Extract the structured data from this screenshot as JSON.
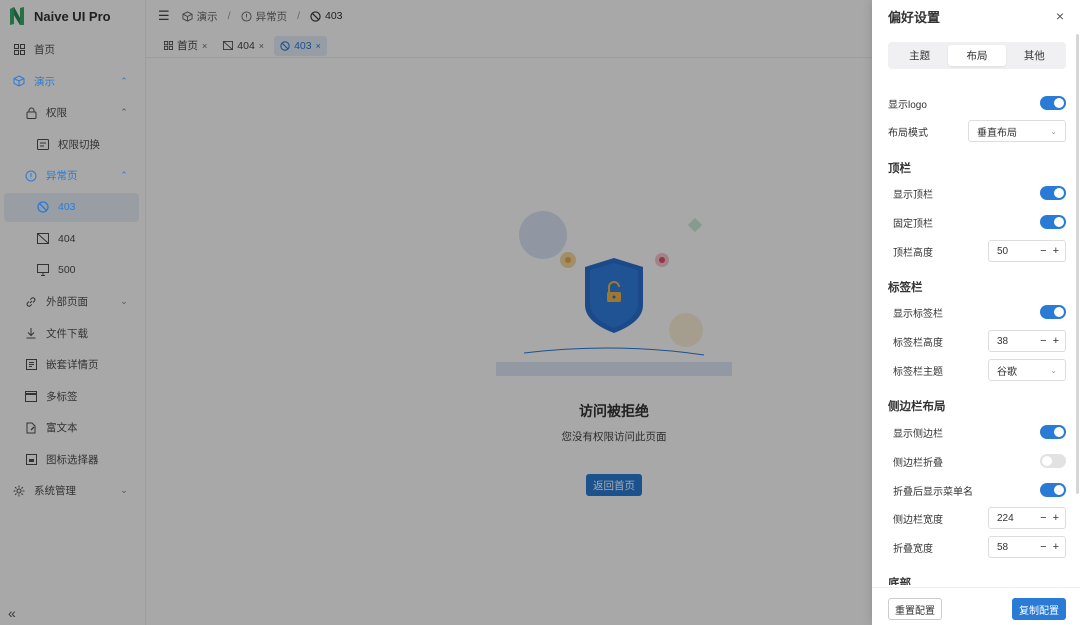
{
  "app": {
    "name": "Naive UI Pro"
  },
  "sidebar": {
    "items": [
      {
        "label": "首页",
        "icon": "dashboard-icon"
      },
      {
        "label": "演示",
        "icon": "cube-icon",
        "chevron": "⌃"
      },
      {
        "label": "权限",
        "icon": "lock-icon",
        "chevron": "⌃"
      },
      {
        "label": "权限切换",
        "icon": "switch-icon"
      },
      {
        "label": "异常页",
        "icon": "warning-circle-icon",
        "chevron": "⌃"
      },
      {
        "label": "403",
        "icon": "forbidden-icon"
      },
      {
        "label": "404",
        "icon": "image-broken-icon"
      },
      {
        "label": "500",
        "icon": "monitor-error-icon"
      },
      {
        "label": "外部页面",
        "icon": "link-icon",
        "chevron": "⌄"
      },
      {
        "label": "文件下载",
        "icon": "download-icon"
      },
      {
        "label": "嵌套详情页",
        "icon": "detail-icon"
      },
      {
        "label": "多标签",
        "icon": "window-icon"
      },
      {
        "label": "富文本",
        "icon": "document-edit-icon"
      },
      {
        "label": "图标选择器",
        "icon": "image-icon"
      },
      {
        "label": "系统管理",
        "icon": "gear-icon",
        "chevron": "⌄"
      }
    ],
    "collapse_glyph": "«"
  },
  "header": {
    "menu_glyph": "☰",
    "breadcrumb": [
      "演示",
      "异常页",
      "403"
    ],
    "sep": "/"
  },
  "tabs": [
    {
      "label": "首页"
    },
    {
      "label": "404"
    },
    {
      "label": "403"
    }
  ],
  "tab_close": "×",
  "main": {
    "title": "访问被拒绝",
    "desc": "您没有权限访问此页面",
    "back_button": "返回首页"
  },
  "drawer": {
    "title": "偏好设置",
    "close": "×",
    "tabs": [
      "主题",
      "布局",
      "其他"
    ],
    "show_logo": "显示logo",
    "layout_mode_label": "布局模式",
    "layout_mode_value": "垂直布局",
    "header_section": "顶栏",
    "show_header": "显示顶栏",
    "fixed_header": "固定顶栏",
    "header_height_label": "顶栏高度",
    "header_height": "50",
    "tabbar_section": "标签栏",
    "show_tabbar": "显示标签栏",
    "tabbar_height_label": "标签栏高度",
    "tabbar_height": "38",
    "tabbar_theme_label": "标签栏主题",
    "tabbar_theme_value": "谷歌",
    "sidebar_section": "侧边栏布局",
    "show_sidebar": "显示侧边栏",
    "sidebar_collapse": "侧边栏折叠",
    "show_menu_name": "折叠后显示菜单名",
    "sidebar_width_label": "侧边栏宽度",
    "sidebar_width": "224",
    "collapsed_width_label": "折叠宽度",
    "collapsed_width": "58",
    "footer_section": "底部",
    "reset": "重置配置",
    "copy": "复制配置",
    "minus": "−",
    "plus": "+",
    "dropdown": "⌄"
  },
  "colors": {
    "primary": "#2a7bd6",
    "mask": "rgba(0,0,0,0.34)"
  }
}
